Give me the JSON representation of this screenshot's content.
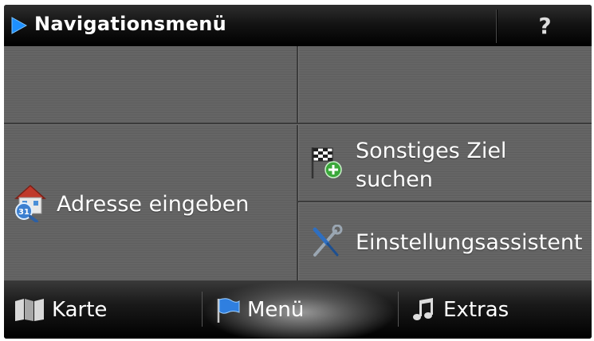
{
  "title_bar": {
    "title": "Navigationsmenü",
    "help_label": "?"
  },
  "menu": {
    "address": {
      "label": "Adresse eingeben",
      "icon": "house-search-icon"
    },
    "other_target": {
      "label_line1": "Sonstiges Ziel",
      "label_line2": "suchen",
      "icon": "checkered-flag-add-icon"
    },
    "setup": {
      "label": "Einstellungsassistent",
      "icon": "tools-icon"
    }
  },
  "tabs": [
    {
      "label": "Karte",
      "icon": "map-icon",
      "active": false
    },
    {
      "label": "Menü",
      "icon": "flag-icon",
      "active": true
    },
    {
      "label": "Extras",
      "icon": "music-note-icon",
      "active": false
    }
  ],
  "colors": {
    "accent": "#1e90ff",
    "panel": "#616161",
    "bar": "#000000"
  }
}
